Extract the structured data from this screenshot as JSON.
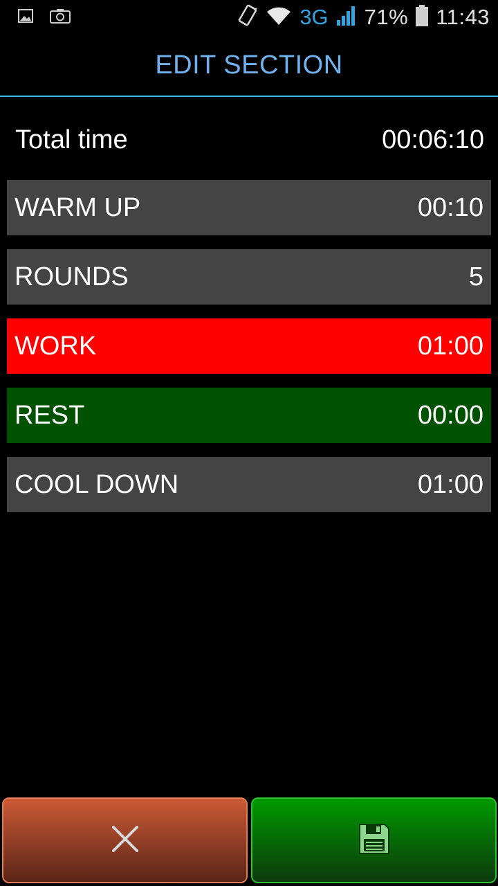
{
  "status_bar": {
    "left_icons": [
      "gallery-icon",
      "camera-icon"
    ],
    "network": "3G",
    "battery": "71%",
    "time": "11:43"
  },
  "header": {
    "title": "EDIT SECTION"
  },
  "total": {
    "label": "Total time",
    "value": "00:06:10"
  },
  "rows": [
    {
      "label": "WARM UP",
      "value": "00:10"
    },
    {
      "label": "ROUNDS",
      "value": "5"
    },
    {
      "label": "WORK",
      "value": "01:00"
    },
    {
      "label": "REST",
      "value": "00:00"
    },
    {
      "label": "COOL DOWN",
      "value": "01:00"
    }
  ],
  "buttons": {
    "cancel_icon": "close-icon",
    "save_icon": "floppy-disk-icon"
  },
  "colors": {
    "title": "#6fb2ef",
    "divider": "#33b5e5",
    "row_default": "#444444",
    "work": "#ff0000",
    "rest": "#005200",
    "cancel": "#cc5a36",
    "save": "#009a00"
  }
}
